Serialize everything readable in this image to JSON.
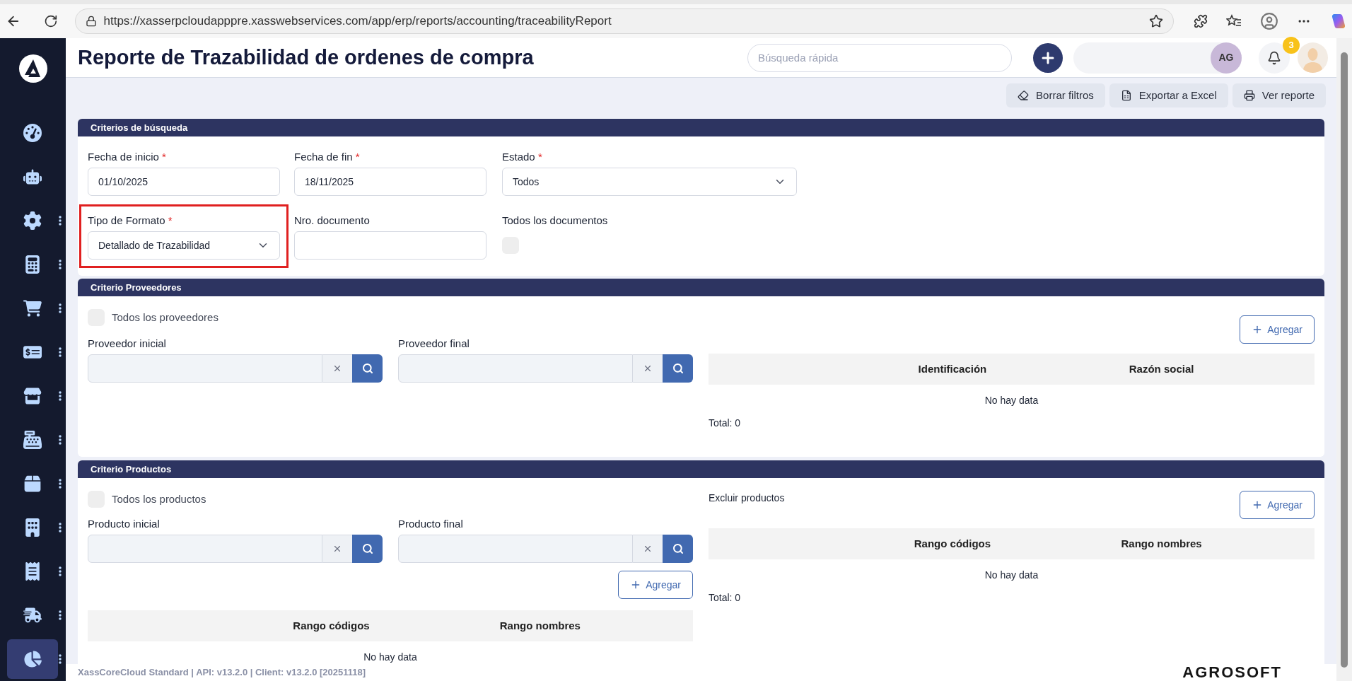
{
  "browser": {
    "url": "https://xasserpcloudapppre.xasswebservices.com/app/erp/reports/accounting/traceabilityReport"
  },
  "sidebar": {
    "items": [
      {
        "selected": false,
        "has_menu": false
      },
      {
        "selected": false,
        "has_menu": false
      },
      {
        "selected": false,
        "has_menu": true
      },
      {
        "selected": false,
        "has_menu": true
      },
      {
        "selected": false,
        "has_menu": true
      },
      {
        "selected": false,
        "has_menu": true
      },
      {
        "selected": false,
        "has_menu": true
      },
      {
        "selected": false,
        "has_menu": true
      },
      {
        "selected": false,
        "has_menu": true
      },
      {
        "selected": false,
        "has_menu": true
      },
      {
        "selected": false,
        "has_menu": true
      },
      {
        "selected": false,
        "has_menu": true
      },
      {
        "selected": true,
        "has_menu": true
      }
    ]
  },
  "header": {
    "title": "Reporte de Trazabilidad de ordenes de compra",
    "search": {
      "placeholder": "Búsqueda rápida"
    },
    "user_initials": "AG",
    "notifications": "3"
  },
  "toolbar": [
    {
      "kind": "eraser",
      "label": "Borrar filtros"
    },
    {
      "kind": "excel",
      "label": "Exportar a Excel"
    },
    {
      "kind": "print",
      "label": "Ver reporte"
    }
  ],
  "search_criteria": {
    "title": "Criterios de búsqueda",
    "fields": [
      {
        "kind": "input",
        "label": "Fecha de inicio",
        "required_mark": "*",
        "value": "01/10/2025",
        "highlighted": false
      },
      {
        "kind": "input",
        "label": "Fecha de fin",
        "required_mark": "*",
        "value": "18/11/2025",
        "highlighted": false
      },
      {
        "kind": "select",
        "label": "Estado",
        "required_mark": "*",
        "value": "Todos",
        "highlighted": false
      },
      {
        "kind": "select",
        "label": "Tipo de Formato",
        "required_mark": "*",
        "value": "Detallado de Trazabilidad",
        "highlighted": true
      },
      {
        "kind": "input",
        "label": "Nro. documento",
        "highlighted": false
      },
      {
        "kind": "checkbox",
        "label": "Todos los documentos",
        "checked": false,
        "highlighted": false
      }
    ]
  },
  "suppliers": {
    "title": "Criterio Proveedores",
    "all_checkbox": {
      "label": "Todos los proveedores",
      "checked": false
    },
    "range": [
      {
        "label": "Proveedor inicial"
      },
      {
        "label": "Proveedor final"
      }
    ],
    "add_button": "Agregar",
    "table": {
      "columns": [
        "Identificación",
        "Razón social"
      ],
      "empty": "No hay data",
      "total": "Total: 0"
    }
  },
  "products": {
    "title": "Criterio Productos",
    "all_checkbox": {
      "label": "Todos los productos",
      "checked": false
    },
    "range": [
      {
        "label": "Producto inicial"
      },
      {
        "label": "Producto final"
      }
    ],
    "add_button": "Agregar",
    "table": {
      "columns": [
        "Rango códigos",
        "Rango nombres"
      ],
      "empty": "No hay data"
    },
    "exclude": {
      "title": "Excluir productos",
      "add_button": "Agregar",
      "table": {
        "columns": [
          "Rango códigos",
          "Rango nombres"
        ],
        "empty": "No hay data",
        "total": "Total: 0"
      }
    }
  },
  "footer": {
    "version": "XassCoreCloud Standard | API: v13.2.0 | Client: v13.2.0 [20251118]",
    "brand": "AGROSOFT"
  }
}
